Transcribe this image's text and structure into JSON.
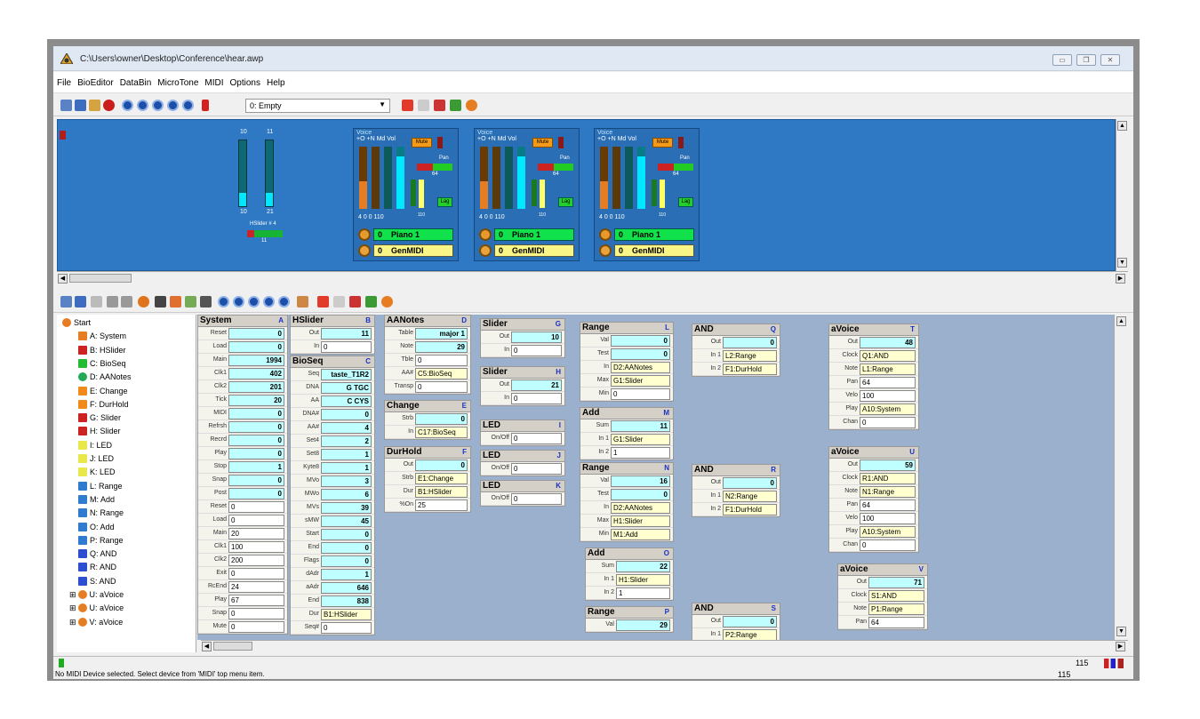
{
  "window": {
    "title": "C:\\Users\\owner\\Desktop\\Conference\\hear.awp",
    "min": "▭",
    "max": "❐",
    "close": "✕"
  },
  "menu": [
    "File",
    "BioEditor",
    "DataBin",
    "MicroTone",
    "MIDI",
    "Options",
    "Help"
  ],
  "toolbar1": {
    "combo": "0: Empty"
  },
  "colors": {
    "blue_panel": "#2e78c4",
    "workspace": "#9bb0cc",
    "green": "#11e14a",
    "orange": "#f39a18",
    "cyan": "#00e8ff"
  },
  "blue": {
    "hslider": {
      "a_top": "10",
      "a_bot": "10",
      "a_level": 0.2,
      "b_top": "11",
      "b_bot": "21",
      "b_level": 0.2,
      "label": "HSlider # 4",
      "val": "11"
    },
    "voices": [
      {
        "voice": "Voice",
        "hdr": "+O +N Md Vol",
        "mute": "Mute",
        "pan": "Pan",
        "pan_val": "64",
        "lag": "Lag",
        "bottom": "4  0  0 110",
        "vol": "110",
        "program": "0",
        "instrument": "Piano 1",
        "bank": "0",
        "bank_name": "GenMIDI"
      },
      {
        "voice": "Voice",
        "hdr": "+O +N Md Vol",
        "mute": "Mute",
        "pan": "Pan",
        "pan_val": "64",
        "lag": "Lag",
        "bottom": "4  0  0 110",
        "vol": "110",
        "program": "0",
        "instrument": "Piano 1",
        "bank": "0",
        "bank_name": "GenMIDI"
      },
      {
        "voice": "Voice",
        "hdr": "+O +N Md Vol",
        "mute": "Mute",
        "pan": "Pan",
        "pan_val": "64",
        "lag": "Lag",
        "bottom": "4  0  0 110",
        "vol": "110",
        "program": "0",
        "instrument": "Piano 1",
        "bank": "0",
        "bank_name": "GenMIDI"
      }
    ]
  },
  "tree": [
    "Start",
    "A: System",
    "B: HSlider",
    "C: BioSeq",
    "D: AANotes",
    "E: Change",
    "F: DurHold",
    "G: Slider",
    "H: Slider",
    "I: LED",
    "J: LED",
    "K: LED",
    "L: Range",
    "M: Add",
    "N: Range",
    "O: Add",
    "P: Range",
    "Q: AND",
    "R: AND",
    "S: AND",
    "U: aVoice",
    "U: aVoice",
    "V: aVoice"
  ],
  "boxes": {
    "system": {
      "title": "System",
      "ltr": "A",
      "rows": [
        [
          "Reset",
          "0",
          "c"
        ],
        [
          "Load",
          "0",
          "c"
        ],
        [
          "Main",
          "1994",
          "c"
        ],
        [
          "Clk1",
          "402",
          "c"
        ],
        [
          "Clk2",
          "201",
          "c"
        ],
        [
          "Tick",
          "20",
          "c"
        ],
        [
          "MIDI",
          "0",
          "c"
        ],
        [
          "Refrsh",
          "0",
          "c"
        ],
        [
          "Recrd",
          "0",
          "c"
        ],
        [
          "Play",
          "0",
          "c"
        ],
        [
          "Stop",
          "1",
          "c"
        ],
        [
          "Snap",
          "0",
          "c"
        ],
        [
          "Post",
          "0",
          "c"
        ],
        [
          "Reset",
          "0",
          "w"
        ],
        [
          "Load",
          "0",
          "w"
        ],
        [
          "Main",
          "20",
          "w"
        ],
        [
          "Clk1",
          "100",
          "w"
        ],
        [
          "Clk2",
          "200",
          "w"
        ],
        [
          "Exit",
          "0",
          "w"
        ],
        [
          "RcEnd",
          "24",
          "w"
        ],
        [
          "Play",
          "67",
          "w"
        ],
        [
          "Snap",
          "0",
          "w"
        ],
        [
          "Mute",
          "0",
          "w"
        ]
      ]
    },
    "hslider": {
      "title": "HSlider",
      "ltr": "B",
      "rows": [
        [
          "Out",
          "11",
          "c"
        ],
        [
          "In",
          "0",
          "w"
        ]
      ]
    },
    "bioseq": {
      "title": "BioSeq",
      "ltr": "C",
      "rows": [
        [
          "Seq",
          "taste_T1R2",
          "c"
        ],
        [
          "DNA",
          "G TGC",
          "c"
        ],
        [
          "AA",
          "C CYS",
          "c"
        ],
        [
          "DNA#",
          "0",
          "c"
        ],
        [
          "AA#",
          "4",
          "c"
        ],
        [
          "Set4",
          "2",
          "c"
        ],
        [
          "Set8",
          "1",
          "c"
        ],
        [
          "Kyte8",
          "1",
          "c"
        ],
        [
          "MVo",
          "3",
          "c"
        ],
        [
          "MWo",
          "6",
          "c"
        ],
        [
          "MVs",
          "39",
          "c"
        ],
        [
          "sMW",
          "45",
          "c"
        ],
        [
          "Start",
          "0",
          "c"
        ],
        [
          "End",
          "0",
          "c"
        ],
        [
          "Flags",
          "0",
          "c"
        ],
        [
          "dAdr",
          "1",
          "c"
        ],
        [
          "aAdr",
          "646",
          "c"
        ],
        [
          "End",
          "838",
          "c"
        ],
        [
          "Dur",
          "B1:HSlider",
          "y"
        ],
        [
          "Seq#",
          "0",
          "w"
        ]
      ]
    },
    "aanotes": {
      "title": "AANotes",
      "ltr": "D",
      "rows": [
        [
          "Table",
          "major 1",
          "c"
        ],
        [
          "Note",
          "29",
          "c"
        ],
        [
          "Tble",
          "0",
          "w"
        ],
        [
          "AA#",
          "C5:BioSeq",
          "y"
        ],
        [
          "Transp",
          "0",
          "w"
        ]
      ]
    },
    "change": {
      "title": "Change",
      "ltr": "E",
      "rows": [
        [
          "Strb",
          "0",
          "c"
        ],
        [
          "In",
          "C17:BioSeq",
          "y"
        ]
      ]
    },
    "durhold": {
      "title": "DurHold",
      "ltr": "F",
      "rows": [
        [
          "Out",
          "0",
          "c"
        ],
        [
          "Strb",
          "E1:Change",
          "y"
        ],
        [
          "Dur",
          "B1:HSlider",
          "y"
        ],
        [
          "%On",
          "25",
          "w"
        ]
      ]
    },
    "sliderG": {
      "title": "Slider",
      "ltr": "G",
      "rows": [
        [
          "Out",
          "10",
          "c"
        ],
        [
          "In",
          "0",
          "w"
        ]
      ]
    },
    "sliderH": {
      "title": "Slider",
      "ltr": "H",
      "rows": [
        [
          "Out",
          "21",
          "c"
        ],
        [
          "In",
          "0",
          "w"
        ]
      ]
    },
    "ledI": {
      "title": "LED",
      "ltr": "I",
      "rows": [
        [
          "On/Off",
          "0",
          "w"
        ]
      ]
    },
    "ledJ": {
      "title": "LED",
      "ltr": "J",
      "rows": [
        [
          "On/Off",
          "0",
          "w"
        ]
      ]
    },
    "ledK": {
      "title": "LED",
      "ltr": "K",
      "rows": [
        [
          "On/Off",
          "0",
          "w"
        ]
      ]
    },
    "rangeL": {
      "title": "Range",
      "ltr": "L",
      "rows": [
        [
          "Val",
          "0",
          "c"
        ],
        [
          "Test",
          "0",
          "c"
        ],
        [
          "In",
          "D2:AANotes",
          "y"
        ],
        [
          "Max",
          "G1:Slider",
          "y"
        ],
        [
          "Min",
          "0",
          "w"
        ]
      ]
    },
    "addM": {
      "title": "Add",
      "ltr": "M",
      "rows": [
        [
          "Sum",
          "11",
          "c"
        ],
        [
          "In 1",
          "G1:Slider",
          "y"
        ],
        [
          "In 2",
          "1",
          "w"
        ]
      ]
    },
    "rangeN": {
      "title": "Range",
      "ltr": "N",
      "rows": [
        [
          "Val",
          "16",
          "c"
        ],
        [
          "Test",
          "0",
          "c"
        ],
        [
          "In",
          "D2:AANotes",
          "y"
        ],
        [
          "Max",
          "H1:Slider",
          "y"
        ],
        [
          "Min",
          "M1:Add",
          "y"
        ]
      ]
    },
    "addO": {
      "title": "Add",
      "ltr": "O",
      "rows": [
        [
          "Sum",
          "22",
          "c"
        ],
        [
          "In 1",
          "H1:Slider",
          "y"
        ],
        [
          "In 2",
          "1",
          "w"
        ]
      ]
    },
    "rangeP": {
      "title": "Range",
      "ltr": "P",
      "rows": [
        [
          "Val",
          "29",
          "c"
        ]
      ]
    },
    "andQ": {
      "title": "AND",
      "ltr": "Q",
      "rows": [
        [
          "Out",
          "0",
          "c"
        ],
        [
          "In 1",
          "L2:Range",
          "y"
        ],
        [
          "In 2",
          "F1:DurHold",
          "y"
        ]
      ]
    },
    "andR": {
      "title": "AND",
      "ltr": "R",
      "rows": [
        [
          "Out",
          "0",
          "c"
        ],
        [
          "In 1",
          "N2:Range",
          "y"
        ],
        [
          "In 2",
          "F1:DurHold",
          "y"
        ]
      ]
    },
    "andS": {
      "title": "AND",
      "ltr": "S",
      "rows": [
        [
          "Out",
          "0",
          "c"
        ],
        [
          "In 1",
          "P2:Range",
          "y"
        ]
      ]
    },
    "voiceT": {
      "title": "aVoice",
      "ltr": "T",
      "rows": [
        [
          "Out",
          "48",
          "c"
        ],
        [
          "Clock",
          "Q1:AND",
          "y"
        ],
        [
          "Note",
          "L1:Range",
          "y"
        ],
        [
          "Pan",
          "64",
          "w"
        ],
        [
          "Velo",
          "100",
          "w"
        ],
        [
          "Play",
          "A10:System",
          "y"
        ],
        [
          "Chan",
          "0",
          "w"
        ]
      ]
    },
    "voiceU": {
      "title": "aVoice",
      "ltr": "U",
      "rows": [
        [
          "Out",
          "59",
          "c"
        ],
        [
          "Clock",
          "R1:AND",
          "y"
        ],
        [
          "Note",
          "N1:Range",
          "y"
        ],
        [
          "Pan",
          "64",
          "w"
        ],
        [
          "Velo",
          "100",
          "w"
        ],
        [
          "Play",
          "A10:System",
          "y"
        ],
        [
          "Chan",
          "0",
          "w"
        ]
      ]
    },
    "voiceV": {
      "title": "aVoice",
      "ltr": "V",
      "rows": [
        [
          "Out",
          "71",
          "c"
        ],
        [
          "Clock",
          "S1:AND",
          "y"
        ],
        [
          "Note",
          "P1:Range",
          "y"
        ],
        [
          "Pan",
          "64",
          "w"
        ]
      ]
    }
  },
  "status": {
    "text": "No MIDI Device selected. Select device from 'MIDI' top menu item.",
    "count1": "115",
    "count2": "115"
  }
}
